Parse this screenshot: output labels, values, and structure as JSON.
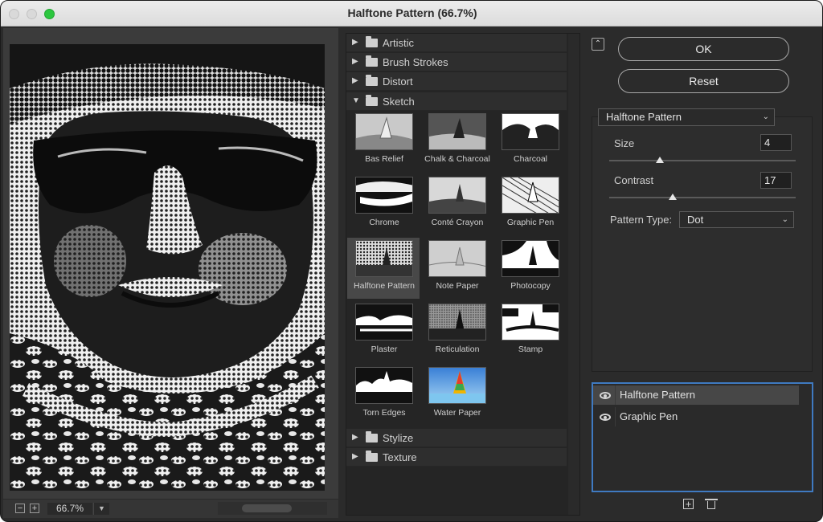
{
  "window": {
    "title": "Halftone Pattern (66.7%)"
  },
  "preview": {
    "zoom_minus": "−",
    "zoom_plus": "+",
    "zoom_value": "66.7%",
    "zoom_dropdown_icon": "chevron-down-icon"
  },
  "gallery": {
    "folders_top": [
      {
        "label": "Artistic",
        "expanded": false
      },
      {
        "label": "Brush Strokes",
        "expanded": false
      },
      {
        "label": "Distort",
        "expanded": false
      },
      {
        "label": "Sketch",
        "expanded": true
      }
    ],
    "sketch_filters": [
      {
        "label": "Bas Relief"
      },
      {
        "label": "Chalk & Charcoal"
      },
      {
        "label": "Charcoal"
      },
      {
        "label": "Chrome"
      },
      {
        "label": "Conté Crayon"
      },
      {
        "label": "Graphic Pen"
      },
      {
        "label": "Halftone Pattern",
        "selected": true
      },
      {
        "label": "Note Paper"
      },
      {
        "label": "Photocopy"
      },
      {
        "label": "Plaster"
      },
      {
        "label": "Reticulation"
      },
      {
        "label": "Stamp"
      },
      {
        "label": "Torn Edges"
      },
      {
        "label": "Water Paper"
      }
    ],
    "folders_bottom": [
      {
        "label": "Stylize",
        "expanded": false
      },
      {
        "label": "Texture",
        "expanded": false
      }
    ]
  },
  "actions": {
    "ok_label": "OK",
    "reset_label": "Reset"
  },
  "settings": {
    "filter_name": "Halftone Pattern",
    "size_label": "Size",
    "size_value": "4",
    "size_min": 1,
    "size_max": 12,
    "contrast_label": "Contrast",
    "contrast_value": "17",
    "contrast_min": 0,
    "contrast_max": 50,
    "pattern_type_label": "Pattern Type:",
    "pattern_type_value": "Dot"
  },
  "layers": [
    {
      "name": "Halftone Pattern",
      "visible": true,
      "active": true
    },
    {
      "name": "Graphic Pen",
      "visible": true,
      "active": false
    }
  ],
  "colors": {
    "accent": "#3f7ac1",
    "background": "#2b2b2b",
    "maximize": "#2cc63f"
  }
}
